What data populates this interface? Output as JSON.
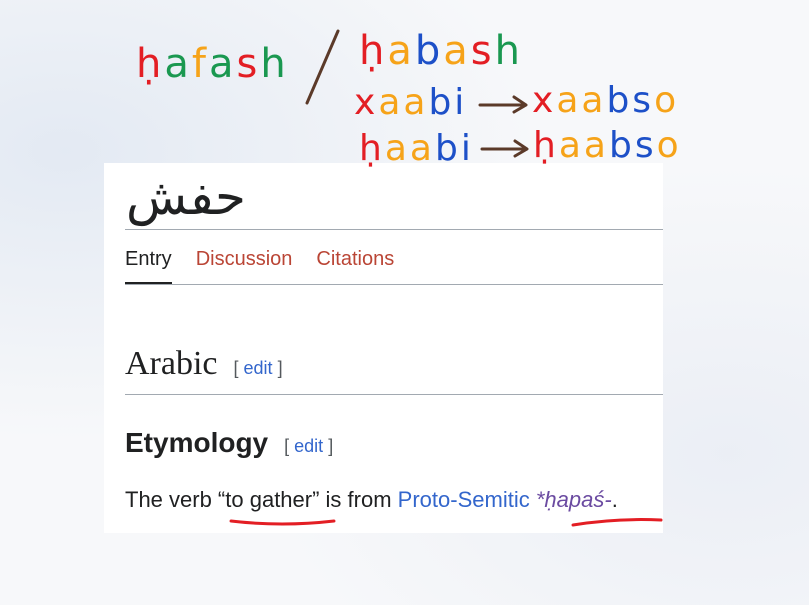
{
  "annotations": {
    "left_word": [
      {
        "ch": "ḥ",
        "color": "#e31e24"
      },
      {
        "ch": "a",
        "color": "#1a9850"
      },
      {
        "ch": "f",
        "color": "#f6a319"
      },
      {
        "ch": "a",
        "color": "#1a9850"
      },
      {
        "ch": "s",
        "color": "#e31e24"
      },
      {
        "ch": "h",
        "color": "#1a9850"
      }
    ],
    "slash": "/",
    "right_word": [
      {
        "ch": "ḥ",
        "color": "#e31e24"
      },
      {
        "ch": "a",
        "color": "#f6a319"
      },
      {
        "ch": "b",
        "color": "#1d50c8"
      },
      {
        "ch": "a",
        "color": "#f6a319"
      },
      {
        "ch": "s",
        "color": "#e31e24"
      },
      {
        "ch": "h",
        "color": "#1a9850"
      }
    ],
    "row1_from": [
      {
        "ch": "x",
        "color": "#e31e24"
      },
      {
        "ch": "a",
        "color": "#f6a319"
      },
      {
        "ch": "a",
        "color": "#f6a319"
      },
      {
        "ch": "b",
        "color": "#1d50c8"
      },
      {
        "ch": "i",
        "color": "#1d50c8"
      }
    ],
    "row1_to": [
      {
        "ch": "x",
        "color": "#e31e24"
      },
      {
        "ch": "a",
        "color": "#f6a319"
      },
      {
        "ch": "a",
        "color": "#f6a319"
      },
      {
        "ch": "b",
        "color": "#1d50c8"
      },
      {
        "ch": "s",
        "color": "#1d50c8"
      },
      {
        "ch": "o",
        "color": "#f6a319"
      }
    ],
    "row2_from": [
      {
        "ch": "ḥ",
        "color": "#e31e24"
      },
      {
        "ch": "a",
        "color": "#f6a319"
      },
      {
        "ch": "a",
        "color": "#f6a319"
      },
      {
        "ch": "b",
        "color": "#1d50c8"
      },
      {
        "ch": "i",
        "color": "#1d50c8"
      }
    ],
    "row2_to": [
      {
        "ch": "ḥ",
        "color": "#e31e24"
      },
      {
        "ch": "a",
        "color": "#f6a319"
      },
      {
        "ch": "a",
        "color": "#f6a319"
      },
      {
        "ch": "b",
        "color": "#1d50c8"
      },
      {
        "ch": "s",
        "color": "#1d50c8"
      },
      {
        "ch": "o",
        "color": "#f6a319"
      }
    ],
    "pen_colors": {
      "red": "#e31e24",
      "brown": "#5b3a29"
    }
  },
  "page": {
    "title": "حفش",
    "tabs": [
      {
        "label": "Entry",
        "selected": true
      },
      {
        "label": "Discussion",
        "selected": false
      },
      {
        "label": "Citations",
        "selected": false
      }
    ],
    "section": {
      "heading": "Arabic",
      "edit_label": "edit"
    },
    "subsection": {
      "heading": "Etymology",
      "edit_label": "edit"
    },
    "etymology": {
      "t1": "The verb “",
      "gloss": "to gather",
      "t2": "” is from ",
      "link1": "Proto-Semitic",
      "t3": " ",
      "link2": "*ḥapaś-",
      "t4": "."
    }
  },
  "colors": {
    "link": "#3366cc",
    "visited_link": "#6b4ba1",
    "tab_link": "#ba4535",
    "text": "#202122"
  }
}
